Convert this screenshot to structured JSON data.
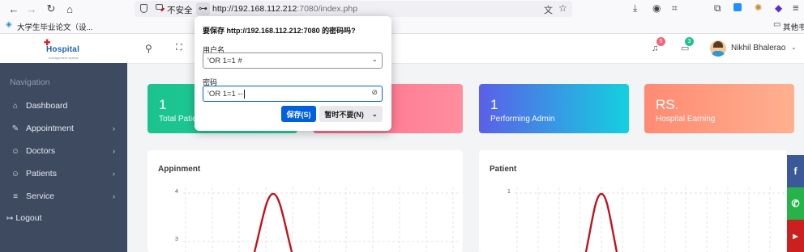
{
  "browser": {
    "url_security": "不安全",
    "url_host": "http://192.168.112.212",
    "url_rest": ":7080/index.php",
    "bookmark_left": "大学生毕业论文（设...",
    "bookmark_right": "其他书签",
    "nav_icons": [
      "back-arrow-icon",
      "forward-arrow-icon",
      "reload-icon",
      "home-icon"
    ]
  },
  "app": {
    "logo_main": "Hospital",
    "logo_sub": "management system",
    "notif_count": "5",
    "message_count": "3",
    "user_name": "Nikhil Bhalerao"
  },
  "sidebar": {
    "heading": "Navigation",
    "items": [
      {
        "label": "Dashboard",
        "icon": "home-icon",
        "glyph": "⌂",
        "chevron": false
      },
      {
        "label": "Appointment",
        "icon": "edit-icon",
        "glyph": "✎",
        "chevron": true
      },
      {
        "label": "Doctors",
        "icon": "user-icon",
        "glyph": "☺",
        "chevron": true
      },
      {
        "label": "Patients",
        "icon": "user-icon",
        "glyph": "☺",
        "chevron": true
      },
      {
        "label": "Service",
        "icon": "menu-icon",
        "glyph": "≡",
        "chevron": true
      }
    ],
    "logout": "Logout"
  },
  "cards": [
    {
      "value": "1",
      "label": "Total Patients",
      "colors": [
        "#1bc28d",
        "#21d3a0"
      ]
    },
    {
      "value": "",
      "label": "",
      "colors": [
        "#ff6b8a",
        "#ff8e9e"
      ]
    },
    {
      "value": "1",
      "label": "Performing Admin",
      "colors": [
        "#5b5fe8",
        "#14d0e0"
      ]
    },
    {
      "value": "RS.",
      "label": "Hospital Earning",
      "colors": [
        "#ff8a73",
        "#ffb08f"
      ]
    }
  ],
  "panels": {
    "left": {
      "title": "Appinment",
      "ticks": [
        "4",
        "3"
      ]
    },
    "right": {
      "title": "Patient",
      "ticks": [
        "1"
      ]
    }
  },
  "dialog": {
    "title": "要保存 http://192.168.112.212:7080 的密码吗?",
    "username_label": "用户名",
    "username_value": "'OR 1=1 #",
    "password_label": "密码",
    "password_value": "'OR 1=1 --",
    "save_label": "保存(S)",
    "notnow_label": "暂时不要(N)"
  },
  "colors": {
    "sidebar": "#3d4a60",
    "save_button": "#0061e0",
    "curve": "#c0141c"
  }
}
